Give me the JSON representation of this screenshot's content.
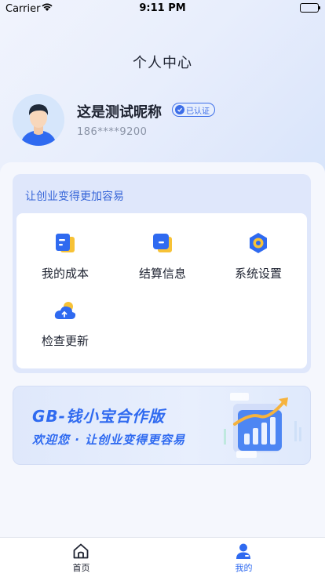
{
  "status_bar": {
    "carrier": "Carrier",
    "time": "9:11 PM"
  },
  "header": {
    "title": "个人中心"
  },
  "profile": {
    "nickname": "这是测试昵称",
    "badge": "已认证",
    "phone": "186****9200"
  },
  "functions": {
    "title": "让创业变得更加容易",
    "items": [
      {
        "label": "我的成本",
        "icon": "document-icon"
      },
      {
        "label": "结算信息",
        "icon": "card-icon"
      },
      {
        "label": "系统设置",
        "icon": "settings-icon"
      },
      {
        "label": "检查更新",
        "icon": "cloud-upload-icon"
      }
    ]
  },
  "banner": {
    "title": "GB-钱小宝合作版",
    "subtitle": "欢迎您 · 让创业变得更容易"
  },
  "tabs": [
    {
      "label": "首页",
      "icon": "home-icon",
      "active": false
    },
    {
      "label": "我的",
      "icon": "user-icon",
      "active": true
    }
  ],
  "colors": {
    "accent": "#3766d8",
    "active_tab": "#2f6af0",
    "inactive_tab": "#1d2230"
  }
}
